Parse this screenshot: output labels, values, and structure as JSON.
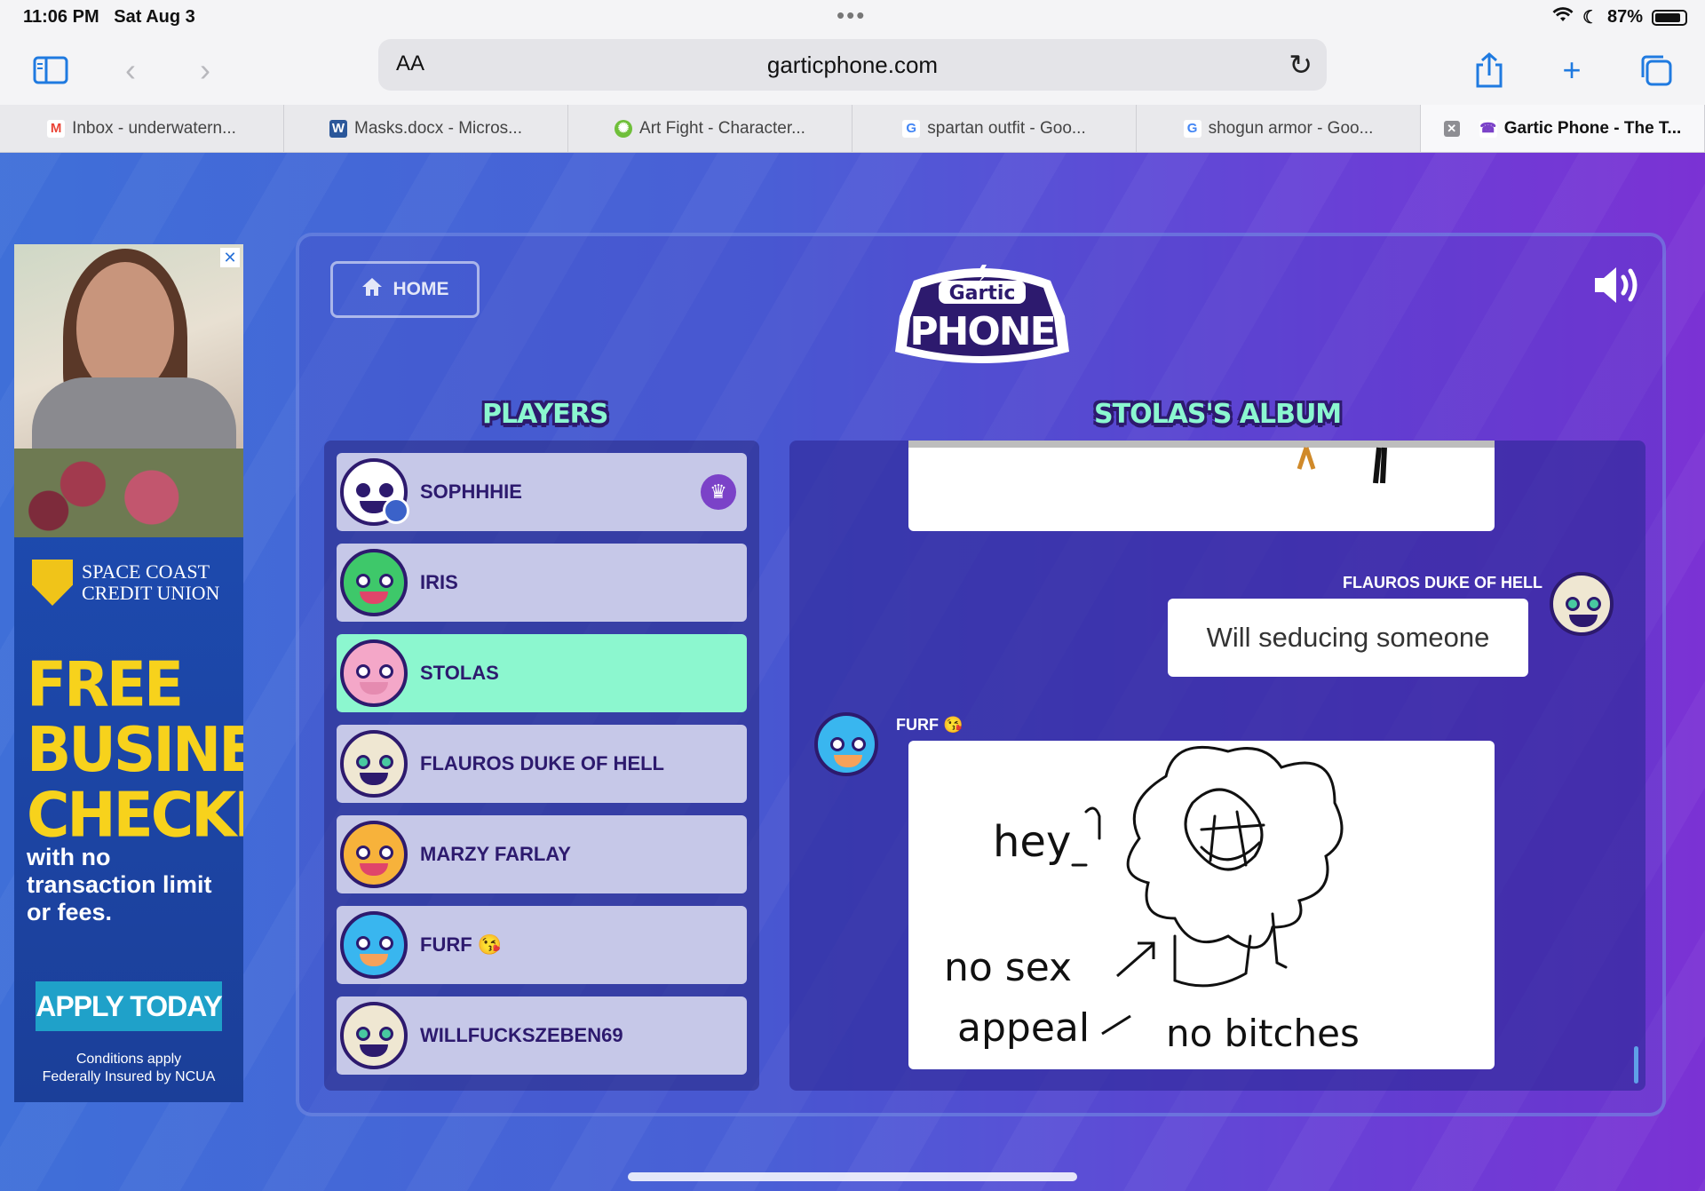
{
  "status_bar": {
    "time": "11:06 PM",
    "date": "Sat Aug 3",
    "battery_percent": "87%",
    "battery_level": 0.87
  },
  "browser": {
    "url": "garticphone.com",
    "aa_label": "AA",
    "tabs": [
      {
        "label": "Inbox - underwatern...",
        "icon": "gmail-icon",
        "color": "#ea4335"
      },
      {
        "label": "Masks.docx - Micros...",
        "icon": "word-icon",
        "color": "#2b579a"
      },
      {
        "label": "Art Fight - Character...",
        "icon": "art-fight-icon",
        "color": "#6fbf3a"
      },
      {
        "label": "spartan outfit - Goo...",
        "icon": "google-icon",
        "color": "#4285f4"
      },
      {
        "label": "shogun armor - Goo...",
        "icon": "google-icon",
        "color": "#4285f4"
      },
      {
        "label": "Gartic Phone - The T...",
        "icon": "gartic-icon",
        "color": "#7b42c8",
        "active": true
      }
    ]
  },
  "ad": {
    "brand": "SPACE COAST CREDIT UNION",
    "brand_line1": "SPACE COAST",
    "brand_line2": "CREDIT UNION",
    "headline_1": "FREE",
    "headline_2": "BUSINESS",
    "headline_3": "CHECKING",
    "sub_1": "with no",
    "sub_2": "transaction limit",
    "sub_3": "or fees.",
    "cta": "APPLY TODAY",
    "fine_1": "Conditions apply",
    "fine_2": "Federally Insured by NCUA",
    "close": "✕"
  },
  "game": {
    "home_label": "HOME",
    "logo_top": "Gartic",
    "logo_bottom": "PHONE",
    "players_title": "PLAYERS",
    "album_title": "STOLAS'S ALBUM",
    "players": [
      {
        "name": "SOPHHHIE",
        "owner": true,
        "color": "#ffffff"
      },
      {
        "name": "IRIS",
        "color": "#3ec86a"
      },
      {
        "name": "STOLAS",
        "active": true,
        "color": "#f4a7c8"
      },
      {
        "name": "FLAUROS DUKE OF HELL",
        "color": "#efe7d2"
      },
      {
        "name": "MARZY FARLAY",
        "color": "#f7b23b"
      },
      {
        "name": "FURF 😘",
        "color": "#39b6ef"
      },
      {
        "name": "WILLFUCKSZEBEN69",
        "color": "#efe7d2"
      }
    ],
    "album": {
      "entry1_author": "FLAUROS DUKE OF HELL",
      "entry1_text": "Will seducing someone",
      "entry2_author": "FURF 😘",
      "drawing_text_1": "hey",
      "drawing_text_2": "no sex",
      "drawing_text_3": "appeal",
      "drawing_text_4": "no bitches"
    }
  }
}
